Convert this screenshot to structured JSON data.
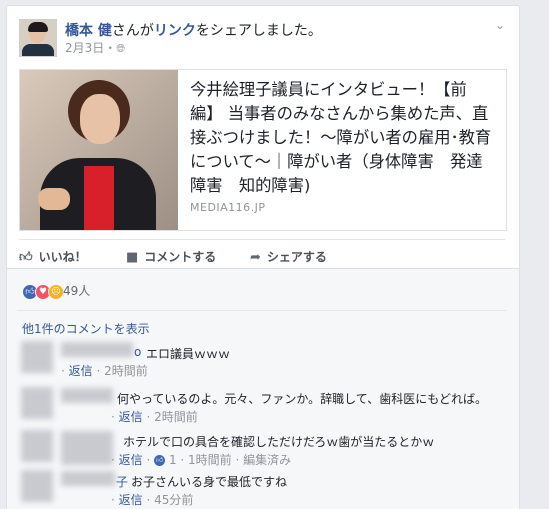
{
  "post": {
    "author": "橋本 健",
    "action_mid": "さんが",
    "action_link": "リンク",
    "action_end": "をシェアしました。",
    "date": "2月3日",
    "privacy_sep": "・",
    "privacy_icon": "globe-icon"
  },
  "link_preview": {
    "title": "今井絵理子議員にインタビュー！【前編】 当事者のみなさんから集めた声、直接ぶつけました！〜障がい者の雇用･教育について〜｜障がい者（身体障害　発達障害　知的障害)",
    "domain": "MEDIA116.JP"
  },
  "actions": {
    "like": "いいね！",
    "comment": "コメントする",
    "share": "シェアする"
  },
  "reactions": {
    "count": "49人",
    "icons": [
      "like-reaction-icon",
      "love-reaction-icon",
      "angry-reaction-icon"
    ],
    "colors": {
      "like": "#4267b2",
      "love": "#f25268",
      "angry": "#f7b125"
    }
  },
  "comments": {
    "view_more": "他1件のコメントを表示",
    "items": [
      {
        "name_visible": "o",
        "text": "エロ議員ｗｗｗ",
        "reply": "返信",
        "time": "2時間前",
        "likes": "",
        "edited": ""
      },
      {
        "name_visible": "",
        "text": "何やっているのよ。元々、ファンか。辞職して、歯科医にもどれば。",
        "reply": "返信",
        "time": "2時間前",
        "likes": "",
        "edited": ""
      },
      {
        "name_visible": "",
        "text": "ホテルで口の具合を確認しただけだろｗ歯が当たるとかｗ",
        "reply": "返信",
        "time": "1時間前",
        "likes": "1",
        "edited": "編集済み"
      },
      {
        "name_visible": "子",
        "text": "お子さんいる身で最低ですね",
        "reply": "返信",
        "time": "45分前",
        "likes": "",
        "edited": ""
      }
    ]
  }
}
